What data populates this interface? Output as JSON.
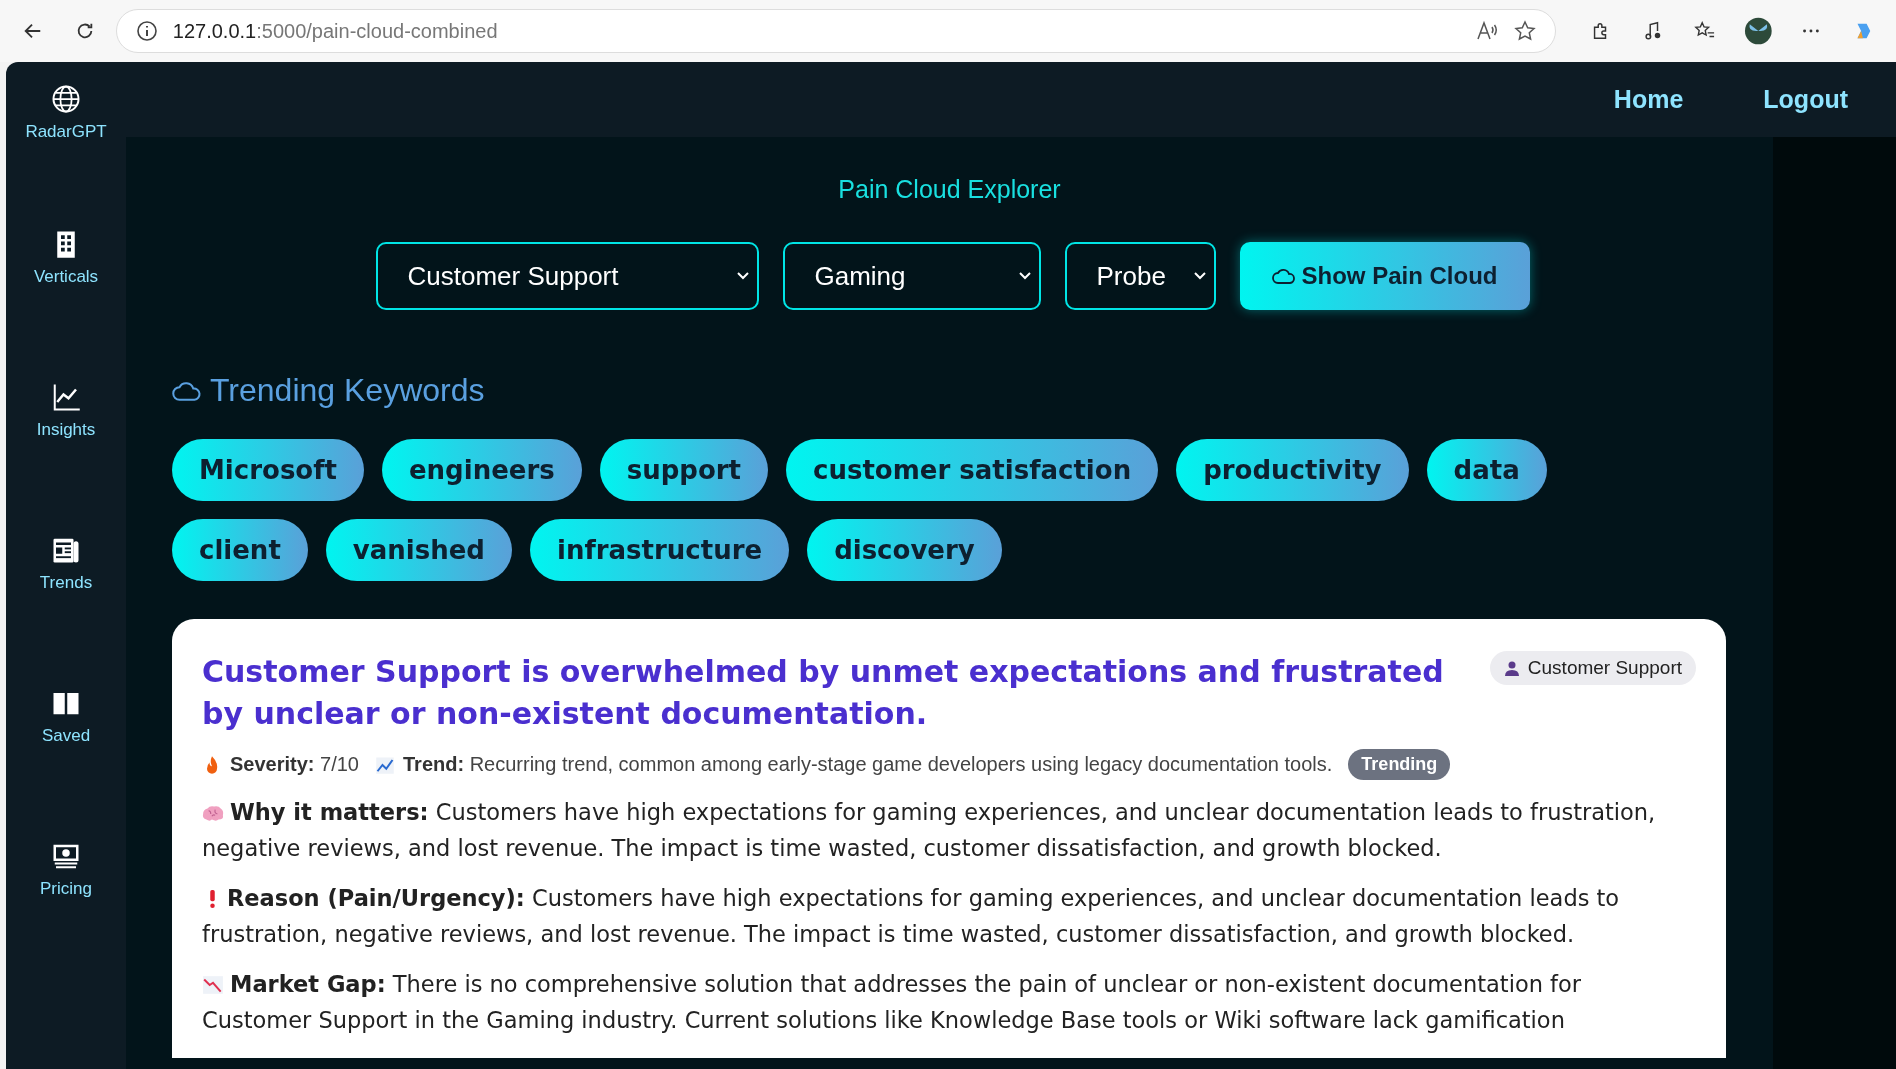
{
  "browser": {
    "url_host": "127.0.0.1",
    "url_path": ":5000/pain-cloud-combined"
  },
  "sidebar": {
    "brand": "RadarGPT",
    "items": [
      {
        "label": "Verticals",
        "kind": "building"
      },
      {
        "label": "Insights",
        "kind": "chart"
      },
      {
        "label": "Trends",
        "kind": "news"
      },
      {
        "label": "Saved",
        "kind": "book"
      },
      {
        "label": "Pricing",
        "kind": "money"
      }
    ]
  },
  "nav": [
    "Home",
    "Logout"
  ],
  "page_title": "Pain Cloud Explorer",
  "filters": [
    {
      "value": "Customer Support"
    },
    {
      "value": "Gaming"
    },
    {
      "value": "Probe"
    }
  ],
  "action_button": "Show Pain Cloud",
  "section_title": "Trending Keywords",
  "keywords": [
    "Microsoft",
    "engineers",
    "support",
    "customer satisfaction",
    "productivity",
    "data",
    "client",
    "vanished",
    "infrastructure",
    "discovery"
  ],
  "card": {
    "title": "Customer Support is overwhelmed by unmet expectations and frustrated by unclear or non-existent documentation.",
    "role": "Customer Support",
    "meta": [
      {
        "kind": "fire",
        "label": "Severity:",
        "value": "7/10"
      },
      {
        "kind": "up",
        "label": "Trend:",
        "value": "Recurring trend, common among early-stage game developers using legacy documentation tools."
      }
    ],
    "status": "Trending",
    "sections": [
      {
        "kind": "brain",
        "label": "Why it matters:",
        "text": "Customers have high expectations for gaming experiences, and unclear documentation leads to frustration, negative reviews, and lost revenue. The impact is time wasted, customer dissatisfaction, and growth blocked."
      },
      {
        "kind": "bang",
        "label": "Reason (Pain/Urgency):",
        "text": "Customers have high expectations for gaming experiences, and unclear documentation leads to frustration, negative reviews, and lost revenue. The impact is time wasted, customer dissatisfaction, and growth blocked."
      },
      {
        "kind": "down",
        "label": "Market Gap:",
        "text": "There is no comprehensive solution that addresses the pain of unclear or non-existent documentation for Customer Support in the Gaming industry. Current solutions like Knowledge Base tools or Wiki software lack gamification"
      }
    ]
  }
}
